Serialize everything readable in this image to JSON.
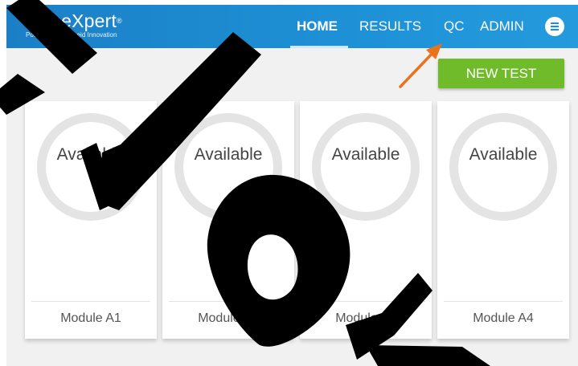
{
  "header": {
    "logo": {
      "name": "GeneXpert",
      "mark": "®",
      "tagline": "Powered by Cepheid Innovation"
    },
    "nav": [
      {
        "label": "HOME",
        "active": true
      },
      {
        "label": "RESULTS",
        "active": false
      },
      {
        "label": "QC",
        "active": false
      },
      {
        "label": "ADMIN",
        "active": false
      }
    ],
    "menu_icon": "hamburger-menu-icon",
    "colors": {
      "bar": "#1e8fd3",
      "accent_green": "#6fbb2a",
      "annotation_arrow": "#e8731c"
    }
  },
  "actions": {
    "new_test_label": "NEW TEST"
  },
  "modules": [
    {
      "status": "Available",
      "name": "Module A1"
    },
    {
      "status": "Available",
      "name": "Module A2"
    },
    {
      "status": "Available",
      "name": "Module A3"
    },
    {
      "status": "Available",
      "name": "Module A4"
    }
  ]
}
